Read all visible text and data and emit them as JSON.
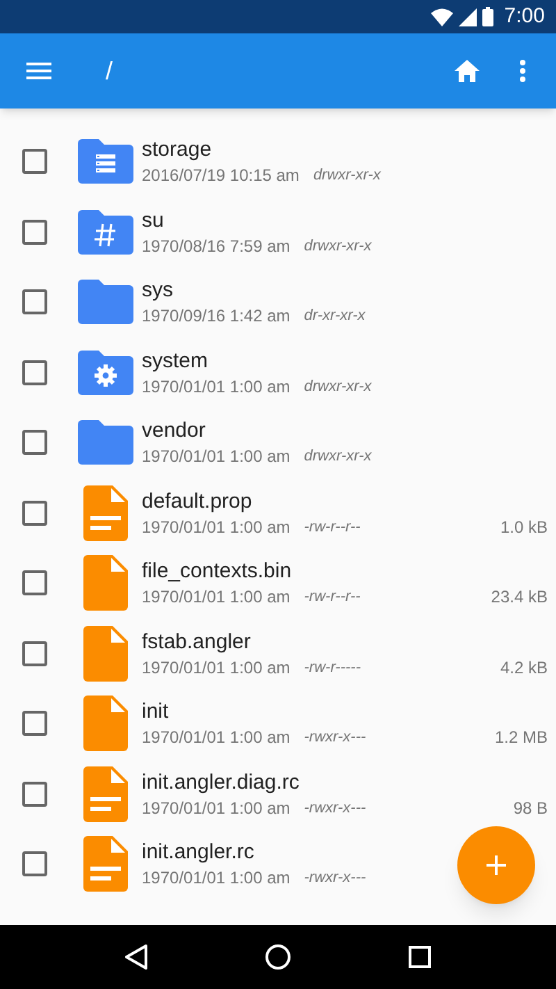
{
  "status_bar": {
    "time": "7:00"
  },
  "app_bar": {
    "path": "/"
  },
  "files": [
    {
      "kind": "storage",
      "name": "storage",
      "date": "2016/07/19 10:15 am",
      "perms": "drwxr-xr-x",
      "checked": false
    },
    {
      "kind": "root",
      "name": "su",
      "date": "1970/08/16 7:59 am",
      "perms": "drwxr-xr-x",
      "checked": false
    },
    {
      "kind": "folder",
      "name": "sys",
      "date": "1970/09/16 1:42 am",
      "perms": "dr-xr-xr-x",
      "checked": false
    },
    {
      "kind": "settings",
      "name": "system",
      "date": "1970/01/01 1:00 am",
      "perms": "drwxr-xr-x",
      "checked": false
    },
    {
      "kind": "folder",
      "name": "vendor",
      "date": "1970/01/01 1:00 am",
      "perms": "drwxr-xr-x",
      "checked": false
    },
    {
      "kind": "text",
      "name": "default.prop",
      "date": "1970/01/01 1:00 am",
      "perms": "-rw-r--r--",
      "size": "1.0 kB",
      "checked": false
    },
    {
      "kind": "file",
      "name": "file_contexts.bin",
      "date": "1970/01/01 1:00 am",
      "perms": "-rw-r--r--",
      "size": "23.4 kB",
      "checked": false
    },
    {
      "kind": "file",
      "name": "fstab.angler",
      "date": "1970/01/01 1:00 am",
      "perms": "-rw-r-----",
      "size": "4.2 kB",
      "checked": false
    },
    {
      "kind": "file",
      "name": "init",
      "date": "1970/01/01 1:00 am",
      "perms": "-rwxr-x---",
      "size": "1.2 MB",
      "checked": false
    },
    {
      "kind": "text",
      "name": "init.angler.diag.rc",
      "date": "1970/01/01 1:00 am",
      "perms": "-rwxr-x---",
      "size": "98 B",
      "checked": false
    },
    {
      "kind": "text",
      "name": "init.angler.rc",
      "date": "1970/01/01 1:00 am",
      "perms": "-rwxr-x---",
      "checked": false
    }
  ]
}
